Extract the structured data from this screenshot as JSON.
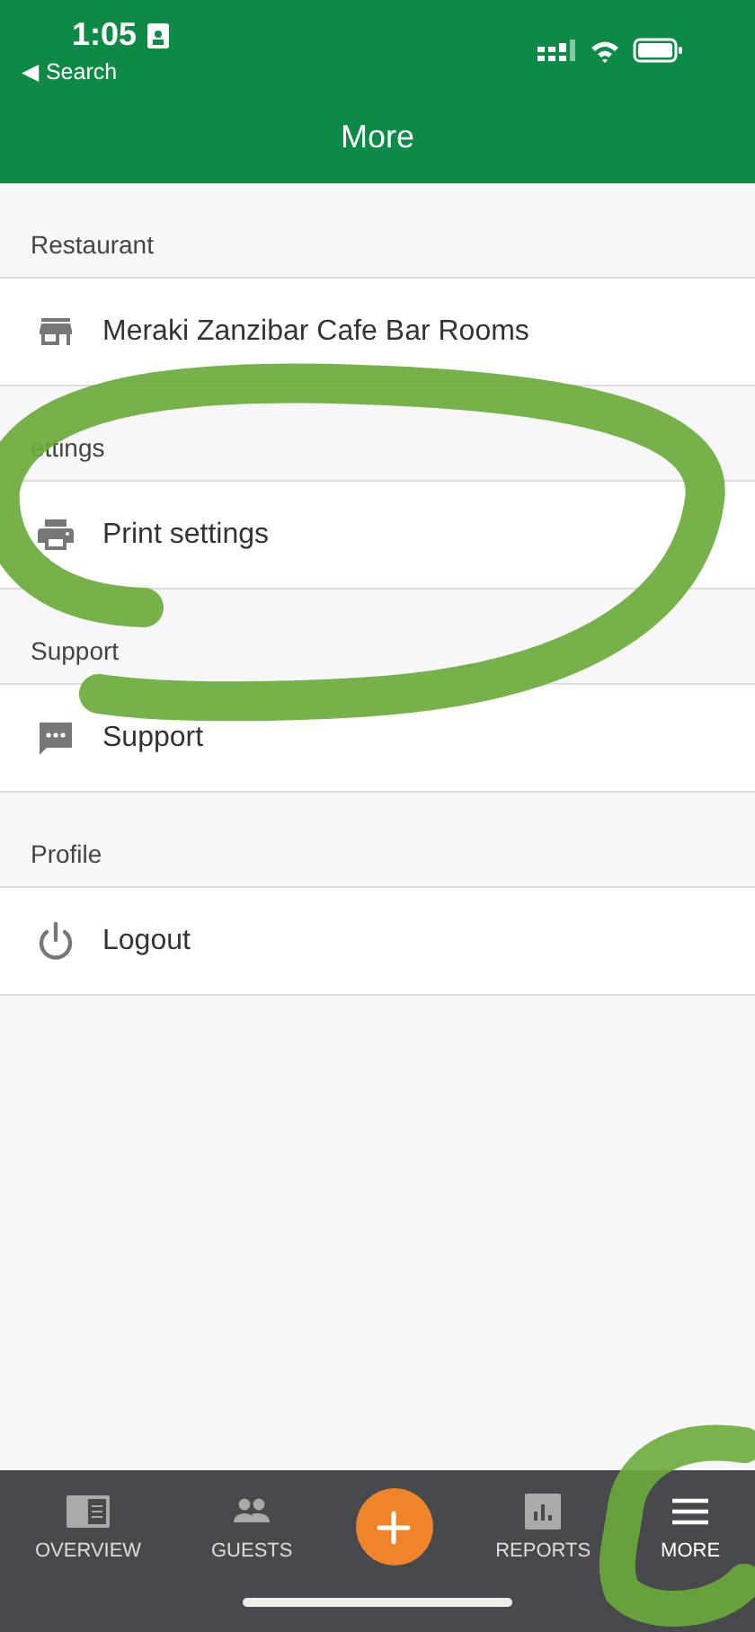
{
  "status_bar": {
    "time": "1:05",
    "back_link": "◀ Search"
  },
  "header": {
    "title": "More"
  },
  "sections": [
    {
      "title": "Restaurant",
      "items": [
        {
          "kind": "store",
          "label": "Meraki Zanzibar Cafe Bar Rooms"
        }
      ]
    },
    {
      "title": "ettings",
      "items": [
        {
          "kind": "printer",
          "label": "Print settings"
        }
      ]
    },
    {
      "title": "Support",
      "items": [
        {
          "kind": "chat",
          "label": "Support"
        }
      ]
    },
    {
      "title": "Profile",
      "items": [
        {
          "kind": "power",
          "label": "Logout"
        }
      ]
    }
  ],
  "tab_bar": [
    {
      "kind": "overview",
      "label": "OVERVIEW",
      "selected": false
    },
    {
      "kind": "guests",
      "label": "GUESTS",
      "selected": false
    },
    {
      "kind": "add",
      "selected": false
    },
    {
      "kind": "reports",
      "label": "REPORTS",
      "selected": false
    },
    {
      "kind": "menu",
      "label": "MORE",
      "selected": true
    }
  ]
}
